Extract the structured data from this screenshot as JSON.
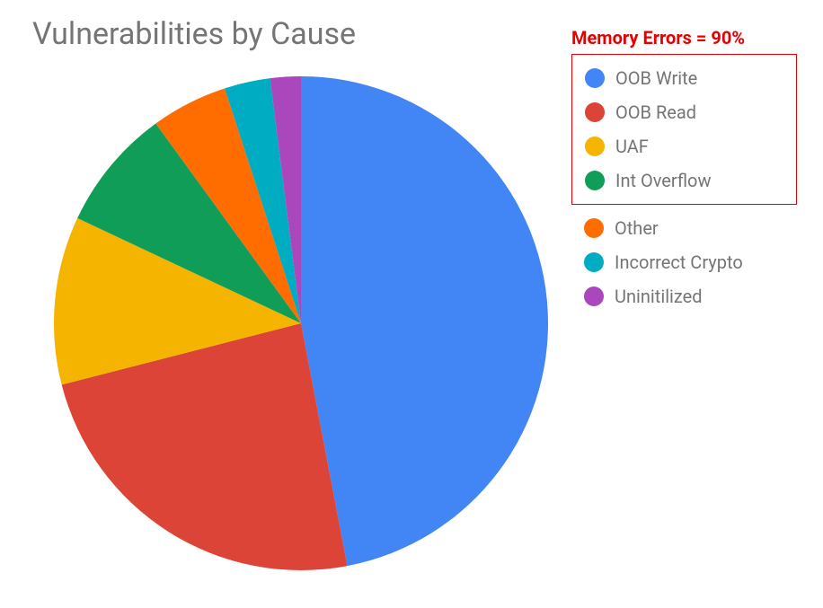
{
  "title": "Vulnerabilities by Cause",
  "annotation": "Memory Errors = 90%",
  "chart_data": {
    "type": "pie",
    "title": "Vulnerabilities by Cause",
    "series": [
      {
        "name": "OOB Write",
        "value": 47,
        "color": "#4285f4"
      },
      {
        "name": "OOB Read",
        "value": 24,
        "color": "#db4437"
      },
      {
        "name": "UAF",
        "value": 11,
        "color": "#f4b400"
      },
      {
        "name": "Int Overflow",
        "value": 8,
        "color": "#0f9d58"
      },
      {
        "name": "Other",
        "value": 5,
        "color": "#ff6d00"
      },
      {
        "name": "Incorrect Crypto",
        "value": 3,
        "color": "#00acc1"
      },
      {
        "name": "Uninitilized",
        "value": 2,
        "color": "#ab47bc"
      }
    ],
    "highlight_group": {
      "label": "Memory Errors",
      "members": [
        "OOB Write",
        "OOB Read",
        "UAF",
        "Int Overflow"
      ],
      "percent": 90
    }
  }
}
